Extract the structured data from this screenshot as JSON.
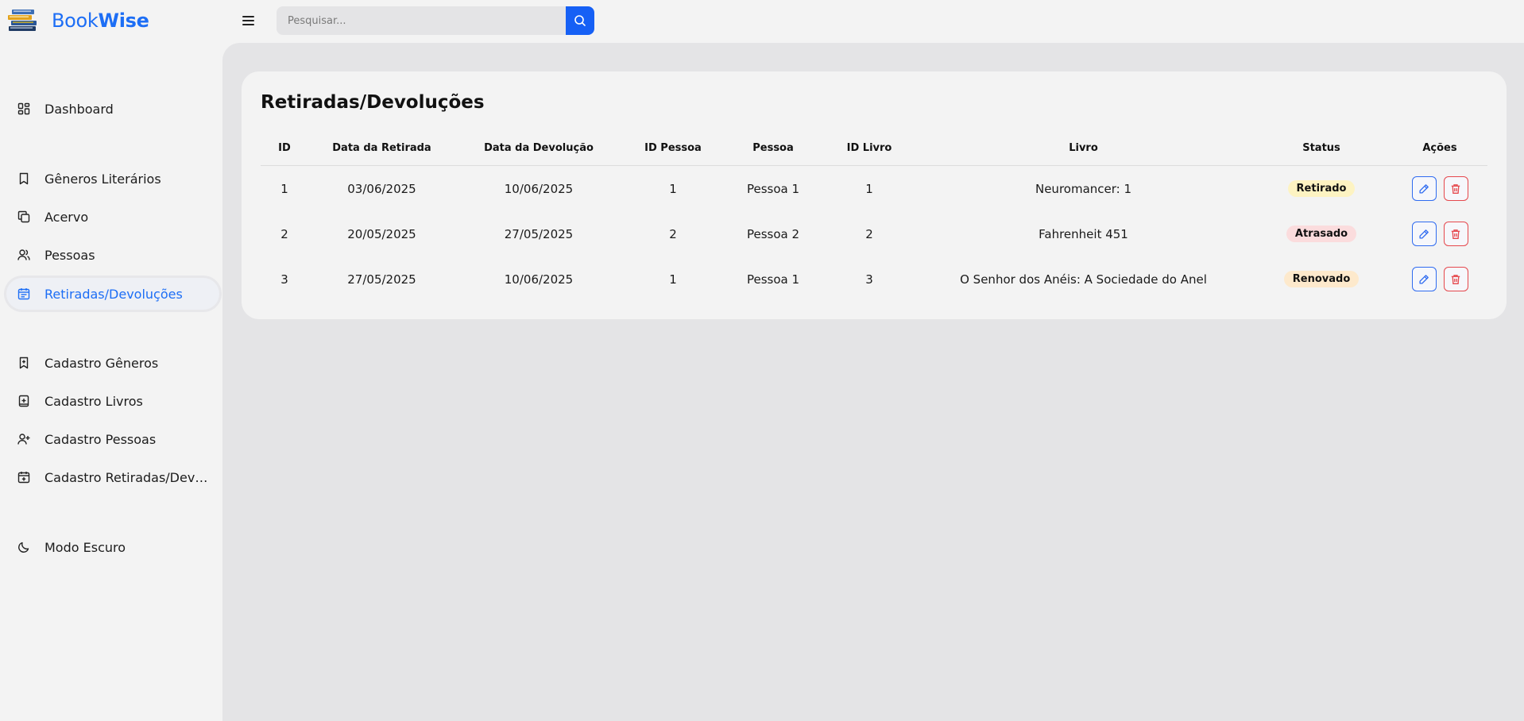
{
  "app": {
    "brand_light": "Book",
    "brand_bold": "Wise",
    "accent_color": "#1d6ef5"
  },
  "search": {
    "placeholder": "Pesquisar..."
  },
  "sidebar": {
    "items": [
      {
        "label": "Dashboard",
        "icon": "dashboard-icon"
      },
      {
        "label": "Gêneros Literários",
        "icon": "bookmark-icon"
      },
      {
        "label": "Acervo",
        "icon": "copy-icon"
      },
      {
        "label": "Pessoas",
        "icon": "users-icon"
      },
      {
        "label": "Retiradas/Devoluções",
        "icon": "calendar-list-icon",
        "active": true
      },
      {
        "label": "Cadastro Gêneros",
        "icon": "bookmark-plus-icon"
      },
      {
        "label": "Cadastro Livros",
        "icon": "book-plus-icon"
      },
      {
        "label": "Cadastro Pessoas",
        "icon": "user-plus-icon"
      },
      {
        "label": "Cadastro Retiradas/Devolu...",
        "icon": "calendar-plus-icon"
      },
      {
        "label": "Modo Escuro",
        "icon": "moon-icon"
      }
    ]
  },
  "main": {
    "title": "Retiradas/Devoluções",
    "columns": [
      "ID",
      "Data da Retirada",
      "Data da Devolução",
      "ID Pessoa",
      "Pessoa",
      "ID Livro",
      "Livro",
      "Status",
      "Ações"
    ],
    "rows": [
      {
        "id": "1",
        "retirada": "03/06/2025",
        "devolucao": "10/06/2025",
        "id_pessoa": "1",
        "pessoa": "Pessoa 1",
        "id_livro": "1",
        "livro": "Neuromancer: 1",
        "status": "Retirado",
        "status_color": "#fdf3c2"
      },
      {
        "id": "2",
        "retirada": "20/05/2025",
        "devolucao": "27/05/2025",
        "id_pessoa": "2",
        "pessoa": "Pessoa 2",
        "id_livro": "2",
        "livro": "Fahrenheit 451",
        "status": "Atrasado",
        "status_color": "#fbdcdd"
      },
      {
        "id": "3",
        "retirada": "27/05/2025",
        "devolucao": "10/06/2025",
        "id_pessoa": "1",
        "pessoa": "Pessoa 1",
        "id_livro": "3",
        "livro": "O Senhor dos Anéis: A Sociedade do Anel",
        "status": "Renovado",
        "status_color": "#fde9cc"
      }
    ]
  }
}
